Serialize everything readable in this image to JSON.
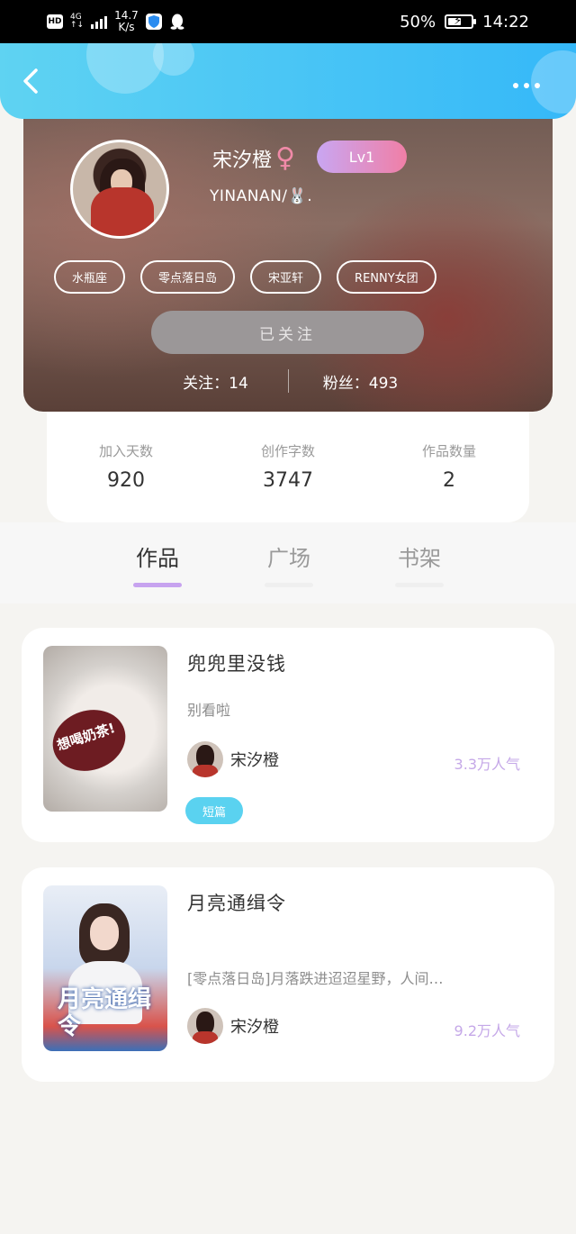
{
  "status_bar": {
    "hd": "HD",
    "network": "4G",
    "speed_value": "14.7",
    "speed_unit": "K/s",
    "battery": "50%",
    "time": "14:22"
  },
  "header": {
    "back_icon": "chevron-left-icon",
    "more_icon": "more-dots-icon"
  },
  "profile": {
    "name": "宋汐橙",
    "gender_icon": "♀",
    "level": "Lv1",
    "nickname": "YINANAN/🐰.",
    "tags": [
      "水瓶座",
      "零点落日岛",
      "宋亚轩",
      "RENNY女团"
    ],
    "follow_button": "已关注",
    "following_label": "关注：",
    "following_count": "14",
    "fans_label": "粉丝：",
    "fans_count": "493"
  },
  "stats": [
    {
      "label": "加入天数",
      "value": "920"
    },
    {
      "label": "创作字数",
      "value": "3747"
    },
    {
      "label": "作品数量",
      "value": "2"
    }
  ],
  "tabs": [
    {
      "label": "作品",
      "active": true
    },
    {
      "label": "广场",
      "active": false
    },
    {
      "label": "书架",
      "active": false
    }
  ],
  "works": [
    {
      "title": "兜兜里没钱",
      "desc": "别看啦",
      "author": "宋汐橙",
      "popularity": "3.3万人气",
      "tag": "短篇",
      "cover_text": "想喝奶茶!"
    },
    {
      "title": "月亮通缉令",
      "desc": "[零点落日岛]月落跌进迢迢星野，人间…",
      "author": "宋汐橙",
      "popularity": "9.2万人气",
      "cover_text": "月亮通缉令"
    }
  ],
  "colors": {
    "header_start": "#5fd3f2",
    "header_end": "#35b8f8",
    "tab_active_underline": "#c7a3ef",
    "popularity": "#c5a8e8",
    "genre_tag": "#5ad2f0"
  }
}
